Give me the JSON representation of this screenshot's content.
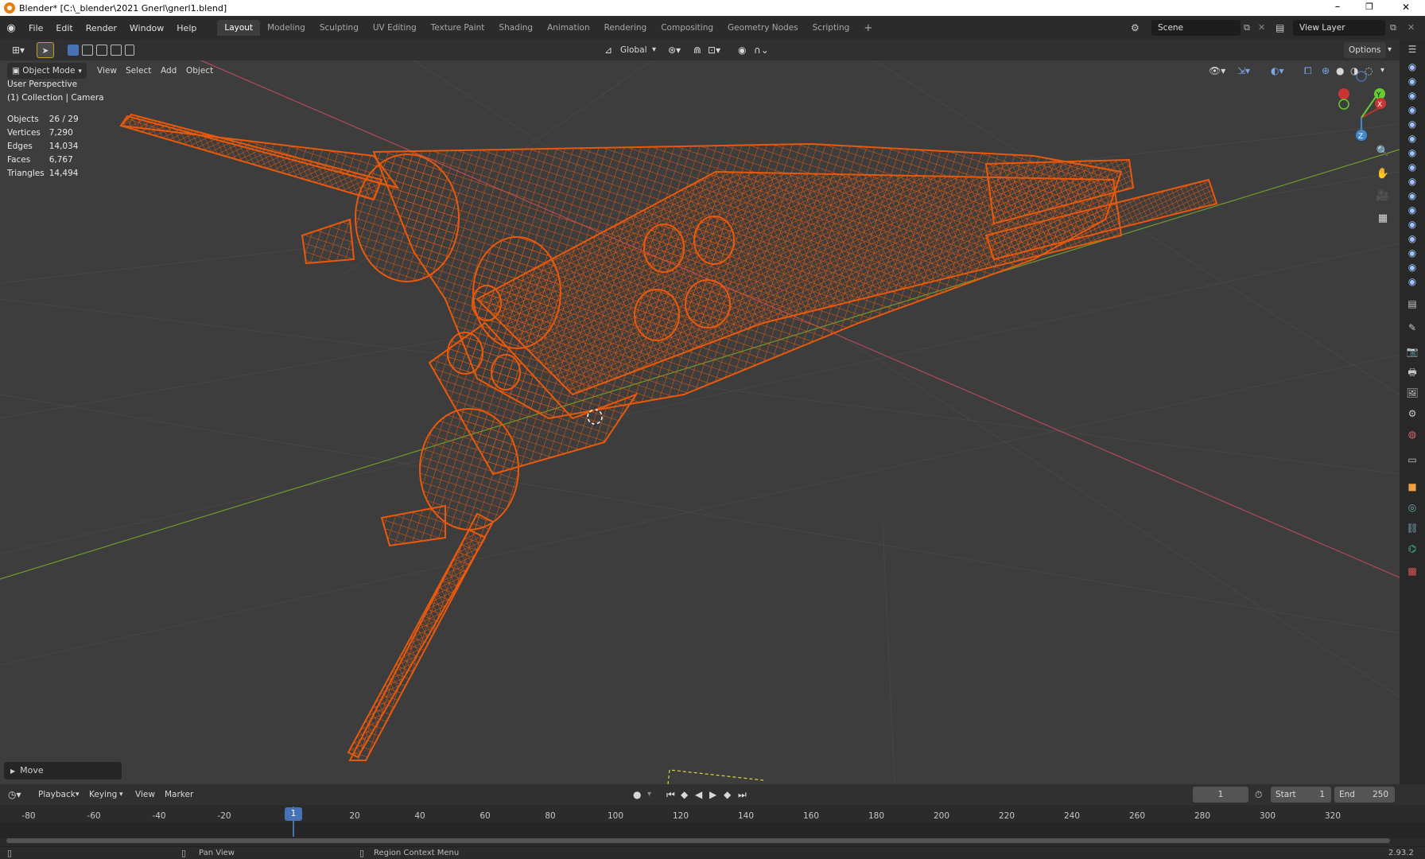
{
  "window": {
    "title": "Blender* [C:\\_blender\\2021 Gnerl\\gnerl1.blend]",
    "minimize": "–",
    "restore": "❐",
    "close": "✕"
  },
  "menus": [
    "File",
    "Edit",
    "Render",
    "Window",
    "Help"
  ],
  "workspaces": [
    "Layout",
    "Modeling",
    "Sculpting",
    "UV Editing",
    "Texture Paint",
    "Shading",
    "Animation",
    "Rendering",
    "Compositing",
    "Geometry Nodes",
    "Scripting"
  ],
  "active_workspace": "Layout",
  "add_workspace": "+",
  "scene": {
    "label": "Scene",
    "view_layer": "View Layer"
  },
  "header": {
    "transform_orientation": "Global",
    "options": "Options"
  },
  "viewport_header": {
    "mode": "Object Mode",
    "items": [
      "View",
      "Select",
      "Add",
      "Object"
    ]
  },
  "overlay": {
    "perspective": "User Perspective",
    "collection": "(1) Collection | Camera",
    "stats": [
      {
        "label": "Objects",
        "value": "26 / 29"
      },
      {
        "label": "Vertices",
        "value": "7,290"
      },
      {
        "label": "Edges",
        "value": "14,034"
      },
      {
        "label": "Faces",
        "value": "6,767"
      },
      {
        "label": "Triangles",
        "value": "14,494"
      }
    ]
  },
  "gizmo": {
    "x": "X",
    "y": "Y",
    "z": "Z"
  },
  "last_operator": "Move",
  "timeline": {
    "menus": [
      "Playback",
      "Keying",
      "View",
      "Marker"
    ],
    "current_frame": "1",
    "start_label": "Start",
    "start": "1",
    "end_label": "End",
    "end": "250",
    "ticks": [
      "-80",
      "-60",
      "-40",
      "-20",
      "1",
      "20",
      "40",
      "60",
      "80",
      "100",
      "120",
      "140",
      "160",
      "180",
      "200",
      "220",
      "240",
      "260",
      "280",
      "300",
      "320"
    ]
  },
  "status": {
    "left": "Pan View",
    "middle": "Region Context Menu",
    "version": "2.93.2"
  },
  "colors": {
    "wire": "#e8590c",
    "viewport_bg": "#3d3d3d",
    "x_axis": "#b04a5a",
    "y_axis": "#6f9a2e",
    "active_tab": "#3d3d3d",
    "frame_marker": "#4772b3"
  }
}
